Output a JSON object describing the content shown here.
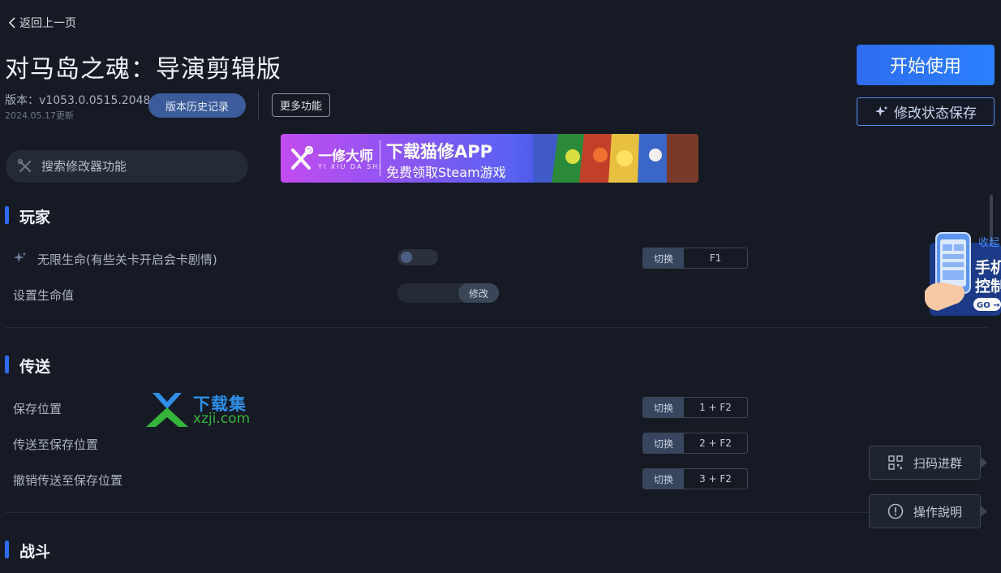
{
  "nav": {
    "back_label": "返回上一页"
  },
  "game": {
    "title": "对马岛之魂：导演剪辑版",
    "version": "版本：v1053.0.0515.2048",
    "updated": "2024.05.17更新"
  },
  "header_buttons": {
    "history": "版本历史记录",
    "more": "更多功能",
    "start": "开始使用",
    "save_state": "修改状态保存"
  },
  "search": {
    "placeholder": "搜索修改器功能"
  },
  "banner": {
    "brand": "一修大师",
    "brand_sub": "YI XIU DA SHI",
    "headline": "下载猫修APP",
    "subline": "免费领取Steam游戏"
  },
  "sections": [
    {
      "title": "玩家",
      "rows": [
        {
          "label": "无限生命(有些关卡开启会卡剧情)",
          "control": "toggle",
          "state": "off",
          "hotkey_tag": "切换",
          "hotkey": "F1"
        },
        {
          "label": "设置生命值",
          "control": "input",
          "button": "修改"
        }
      ]
    },
    {
      "title": "传送",
      "rows": [
        {
          "label": "保存位置",
          "hotkey_tag": "切换",
          "hotkey": "1 + F2"
        },
        {
          "label": "传送至保存位置",
          "hotkey_tag": "切换",
          "hotkey": "2 + F2"
        },
        {
          "label": "撤销传送至保存位置",
          "hotkey_tag": "切换",
          "hotkey": "3 + F2"
        }
      ]
    },
    {
      "title": "战斗",
      "rows": []
    }
  ],
  "side_panel": {
    "collapse": "收起",
    "phone_text_1": "手机",
    "phone_text_2": "控制",
    "phone_go": "GO →",
    "qr_group": "扫码进群",
    "instructions": "操作說明"
  },
  "watermark": {
    "title": "下载集",
    "url": "xzji.com"
  },
  "colors": {
    "accent": "#2f6cf0",
    "background": "#151a24",
    "watermark_blue": "#2f8fe8",
    "watermark_green": "#35b43a"
  }
}
